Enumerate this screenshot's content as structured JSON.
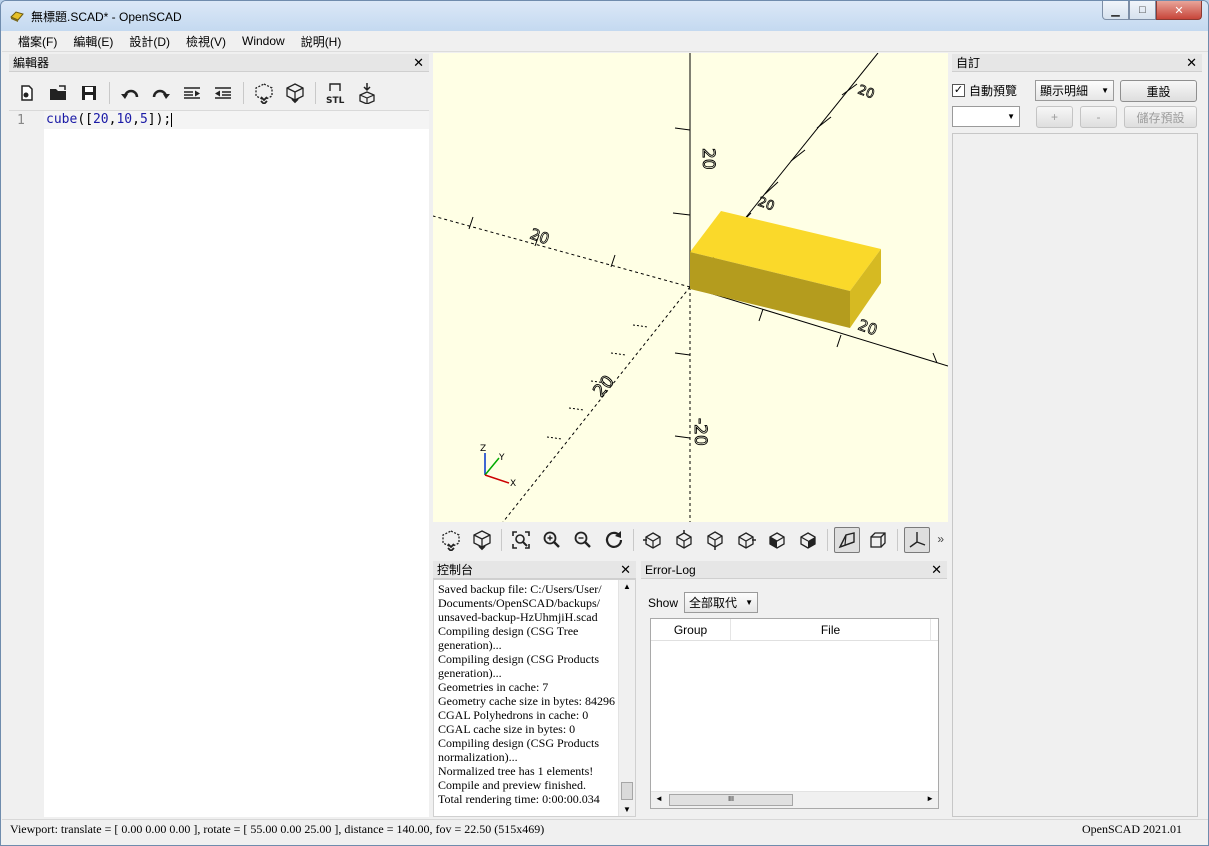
{
  "window": {
    "title": "無標題.SCAD* - OpenSCAD",
    "controls": {
      "minimize": "▁",
      "maximize": "□",
      "close": "✕"
    }
  },
  "menu": [
    "檔案(F)",
    "編輯(E)",
    "設計(D)",
    "檢視(V)",
    "Window",
    "說明(H)"
  ],
  "editor": {
    "title": "編輯器",
    "toolbar_icons": [
      "new-file-icon",
      "open-file-icon",
      "save-icon",
      "undo-icon",
      "redo-icon",
      "unindent-icon",
      "indent-icon",
      "preview-icon",
      "render-icon",
      "export-stl-icon",
      "send-to-print-icon"
    ],
    "line_number": "1",
    "code": {
      "func": "cube",
      "open": "([",
      "a": "20",
      "c1": ",",
      "b": "10",
      "c2": ",",
      "c": "5",
      "close": "]);"
    }
  },
  "viewport": {
    "axis_labels": {
      "y_pos": "20",
      "y_pos_upper": "20",
      "x_neg": "20",
      "x_pos": "20",
      "z_pos": "20",
      "z_neg": "-20",
      "y_neg": "20"
    },
    "gizmo": {
      "z": "Z",
      "y": "Y",
      "x": "X"
    },
    "cube_color": "#fad92a",
    "background": "#ffffe5"
  },
  "view_toolbar": {
    "icons": [
      "preview-icon",
      "render-icon",
      "view-all-icon",
      "zoom-in-icon",
      "zoom-out-icon",
      "reset-view-icon",
      "view-right-icon",
      "view-top-icon",
      "view-bottom-icon",
      "view-left-icon",
      "view-front-icon",
      "view-back-icon",
      "perspective-icon",
      "orthogonal-icon",
      "show-axes-icon"
    ],
    "more": "»"
  },
  "console": {
    "title": "控制台",
    "lines": [
      "Saved backup file: C:/Users/User/",
      "Documents/OpenSCAD/backups/",
      "unsaved-backup-HzUhmjiH.scad",
      "Compiling design (CSG Tree",
      "generation)...",
      "Compiling design (CSG Products",
      "generation)...",
      "Geometries in cache: 7",
      "Geometry cache size in bytes: 84296",
      "CGAL Polyhedrons in cache: 0",
      "CGAL cache size in bytes: 0",
      "Compiling design (CSG Products",
      "normalization)...",
      "Normalized tree has 1 elements!",
      "Compile and preview finished.",
      "Total rendering time: 0:00:00.034"
    ]
  },
  "error_log": {
    "title": "Error-Log",
    "show_label": "Show",
    "filter_value": "全部取代",
    "columns": [
      "Group",
      "File"
    ],
    "scroll_thumb": "III"
  },
  "customizer": {
    "title": "自訂",
    "auto_preview_label": "自動預覽",
    "auto_preview_checked": true,
    "detail_value": "顯示明細",
    "reset_label": "重設",
    "preset_value": "",
    "add_label": "+",
    "remove_label": "-",
    "save_preset_label": "儲存預設"
  },
  "status": {
    "viewport_info": "Viewport: translate = [ 0.00 0.00 0.00 ], rotate = [ 55.00 0.00 25.00 ], distance = 140.00, fov = 22.50 (515x469)",
    "version": "OpenSCAD 2021.01"
  }
}
